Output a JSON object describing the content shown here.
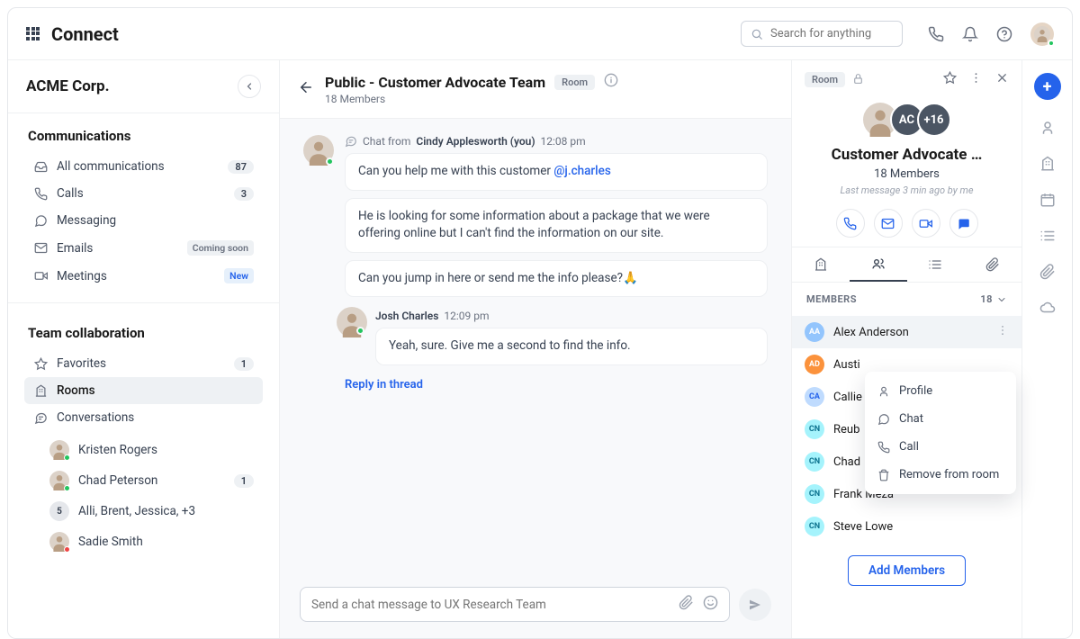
{
  "brand": "Connect",
  "search": {
    "placeholder": "Search for anything"
  },
  "workspace": {
    "name": "ACME Corp."
  },
  "sidebar": {
    "sections": [
      {
        "title": "Communications",
        "items": [
          {
            "label": "All communications",
            "icon": "inbox-icon",
            "badge": "87"
          },
          {
            "label": "Calls",
            "icon": "phone-icon",
            "badge": "3"
          },
          {
            "label": "Messaging",
            "icon": "chat-icon"
          },
          {
            "label": "Emails",
            "icon": "mail-icon",
            "pill": "Coming soon"
          },
          {
            "label": "Meetings",
            "icon": "video-icon",
            "pill": "New",
            "pill_style": "new"
          }
        ]
      },
      {
        "title": "Team collaboration",
        "items": [
          {
            "label": "Favorites",
            "icon": "star-icon",
            "badge": "1"
          },
          {
            "label": "Rooms",
            "icon": "building-icon",
            "active": true
          },
          {
            "label": "Conversations",
            "icon": "conversation-icon"
          }
        ],
        "conversations": [
          {
            "name": "Kristen Rogers",
            "presence": "green"
          },
          {
            "name": "Chad Peterson",
            "presence": "green",
            "badge": "1"
          },
          {
            "name": "Alli, Brent, Jessica, +3",
            "group_count": "5"
          },
          {
            "name": "Sadie Smith",
            "presence": "red"
          }
        ]
      }
    ]
  },
  "chat": {
    "title": "Public - Customer Advocate Team",
    "room_tag": "Room",
    "subtitle": "18 Members",
    "threads": [
      {
        "prefix": "Chat from",
        "author": "Cindy Applesworth (you)",
        "time": "12:08 pm",
        "messages": [
          {
            "text_pre": "Can you help me with this customer ",
            "mention": "@j.charles"
          },
          {
            "text": "He is looking for some information about a package that we were offering online but I can't find the information on our site."
          },
          {
            "text": "Can you jump in here or send me the info please?",
            "emoji": "🙏"
          }
        ]
      },
      {
        "author": "Josh Charles",
        "time": "12:09 pm",
        "messages": [
          {
            "text": "Yeah, sure. Give me a second to find the info."
          }
        ]
      }
    ],
    "reply_link": "Reply in thread",
    "composer_placeholder": "Send a chat message to UX Research Team"
  },
  "details": {
    "room_tag": "Room",
    "stack_initials": "AC",
    "stack_more": "+16",
    "title": "Customer Advocate …",
    "subtitle": "18 Members",
    "last_message": "Last message 3 min ago by me",
    "members_label": "MEMBERS",
    "members_count": "18",
    "members": [
      {
        "initials": "AA",
        "name": "Alex Anderson",
        "color": "#93c5fd",
        "dots": true
      },
      {
        "initials": "AD",
        "name": "Austi",
        "color": "#fb923c"
      },
      {
        "initials": "CA",
        "name": "Callie",
        "color": "#bfdbfe"
      },
      {
        "initials": "CN",
        "name": "Reub",
        "color": "#a5f3fc"
      },
      {
        "initials": "CN",
        "name": "Chad",
        "color": "#a5f3fc"
      },
      {
        "initials": "CN",
        "name": "Frank Meza",
        "color": "#a5f3fc"
      },
      {
        "initials": "CN",
        "name": "Steve Lowe",
        "color": "#a5f3fc"
      }
    ],
    "add_members_label": "Add Members",
    "member_menu": [
      {
        "label": "Profile",
        "icon": "user-icon"
      },
      {
        "label": "Chat",
        "icon": "chat-icon"
      },
      {
        "label": "Call",
        "icon": "phone-icon"
      },
      {
        "label": "Remove from room",
        "icon": "trash-icon"
      }
    ]
  }
}
